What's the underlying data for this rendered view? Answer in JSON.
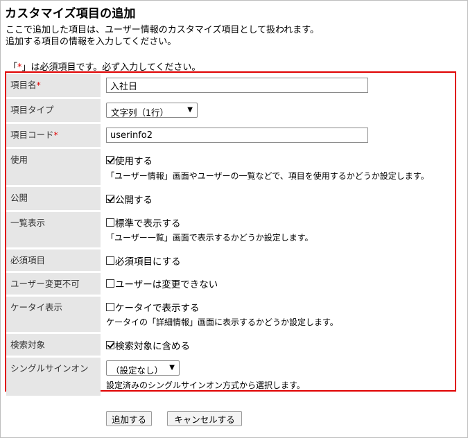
{
  "page": {
    "title": "カスタマイズ項目の追加",
    "desc_line1": "ここで追加した項目は、ユーザー情報のカスタマイズ項目として扱われます。",
    "desc_line2": "追加する項目の情報を入力してください。",
    "required_prefix": "「",
    "required_mark": "*",
    "required_suffix": "」は必須項目です。必ず入力してください。"
  },
  "form": {
    "item_name": {
      "label": "項目名",
      "required_mark": "*",
      "value": "入社日"
    },
    "item_type": {
      "label": "項目タイプ",
      "selected": "文字列（1行）"
    },
    "item_code": {
      "label": "項目コード",
      "required_mark": "*",
      "value": "userinfo2"
    },
    "use": {
      "label": "使用",
      "checkbox_label": "使用する",
      "checked": true,
      "help": "「ユーザー情報」画面やユーザーの一覧などで、項目を使用するかどうか設定します。"
    },
    "public": {
      "label": "公開",
      "checkbox_label": "公開する",
      "checked": true
    },
    "list_display": {
      "label": "一覧表示",
      "checkbox_label": "標準で表示する",
      "checked": false,
      "help": "「ユーザー一覧」画面で表示するかどうか設定します。"
    },
    "required_item": {
      "label": "必須項目",
      "checkbox_label": "必須項目にする",
      "checked": false
    },
    "user_no_change": {
      "label": "ユーザー変更不可",
      "checkbox_label": "ユーザーは変更できない",
      "checked": false
    },
    "mobile_display": {
      "label": "ケータイ表示",
      "checkbox_label": "ケータイで表示する",
      "checked": false,
      "help": "ケータイの「詳細情報」画面に表示するかどうか設定します。"
    },
    "search_target": {
      "label": "検索対象",
      "checkbox_label": "検索対象に含める",
      "checked": true
    },
    "sso": {
      "label": "シングルサインオン",
      "selected": "（設定なし）",
      "help": "設定済みのシングルサインオン方式から選択します。"
    }
  },
  "buttons": {
    "add": "追加する",
    "cancel": "キャンセルする"
  },
  "colors": {
    "required": "#e00000",
    "label_bg": "#e6e6e6",
    "border_highlight": "#e00000"
  }
}
